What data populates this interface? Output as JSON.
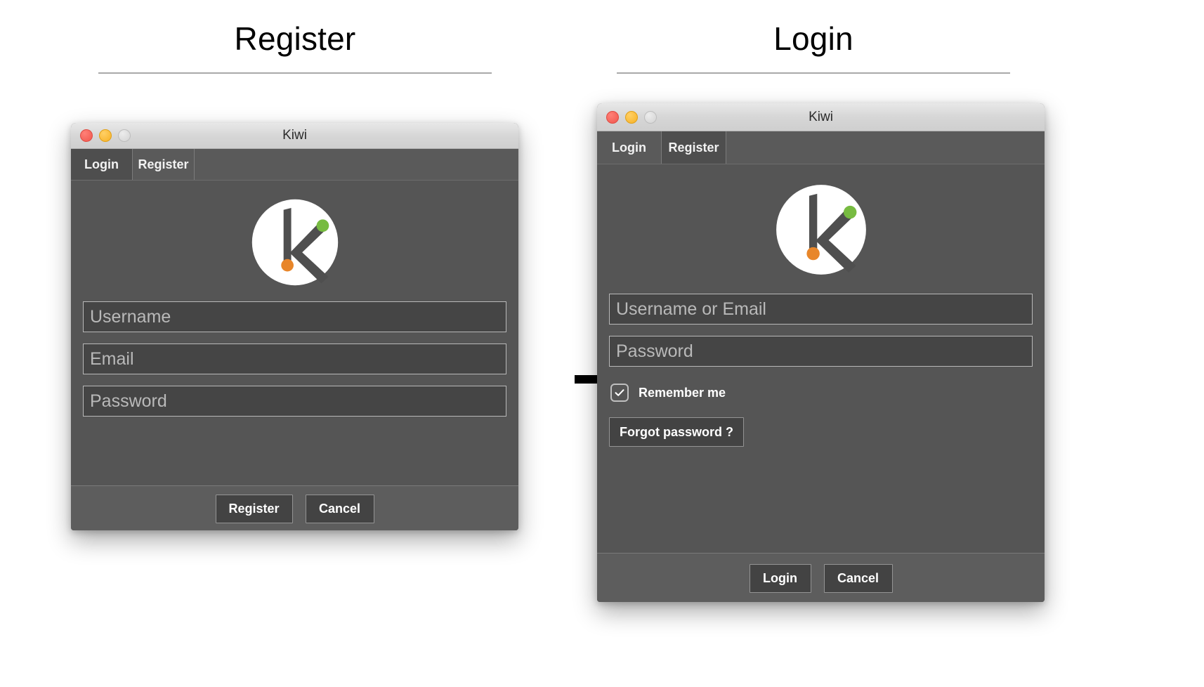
{
  "sections": [
    {
      "title": "Register"
    },
    {
      "title": "Login"
    }
  ],
  "arrow": {
    "icon": "right-arrow-icon"
  },
  "register_window": {
    "title": "Kiwi",
    "traffic_lights": {
      "close": "close-button",
      "minimize": "minimize-button",
      "zoom": "zoom-button",
      "colors": {
        "close": "#f0564d",
        "minimize": "#f7b125",
        "zoom": "#d3d3d3"
      }
    },
    "tabs": [
      {
        "label": "Login",
        "active": false
      },
      {
        "label": "Register",
        "active": true
      }
    ],
    "logo": {
      "name": "kiwi-logo",
      "circle_color": "#ffffff",
      "mark_color": "#4f4f4f",
      "dot_top_color": "#77bb41",
      "dot_bottom_color": "#e8862a"
    },
    "fields": [
      {
        "name": "username-input",
        "placeholder": "Username",
        "value": ""
      },
      {
        "name": "email-input",
        "placeholder": "Email",
        "value": ""
      },
      {
        "name": "password-input",
        "placeholder": "Password",
        "value": ""
      }
    ],
    "buttons": [
      {
        "name": "register-button",
        "label": "Register"
      },
      {
        "name": "cancel-button",
        "label": "Cancel"
      }
    ]
  },
  "login_window": {
    "title": "Kiwi",
    "traffic_lights": {
      "close": "close-button",
      "minimize": "minimize-button",
      "zoom": "zoom-button",
      "colors": {
        "close": "#f0564d",
        "minimize": "#f7b125",
        "zoom": "#d3d3d3"
      }
    },
    "tabs": [
      {
        "label": "Login",
        "active": true
      },
      {
        "label": "Register",
        "active": false
      }
    ],
    "logo": {
      "name": "kiwi-logo",
      "circle_color": "#ffffff",
      "mark_color": "#4f4f4f",
      "dot_top_color": "#77bb41",
      "dot_bottom_color": "#e8862a"
    },
    "fields": [
      {
        "name": "username-or-email-input",
        "placeholder": "Username or Email",
        "value": ""
      },
      {
        "name": "password-input",
        "placeholder": "Password",
        "value": ""
      }
    ],
    "remember_me": {
      "label": "Remember me",
      "checked": true,
      "check_glyph": "✓"
    },
    "forgot_password": {
      "label": "Forgot password ?"
    },
    "buttons": [
      {
        "name": "login-button",
        "label": "Login"
      },
      {
        "name": "cancel-button",
        "label": "Cancel"
      }
    ]
  },
  "theme": {
    "window_bg": "#555555",
    "footer_bg": "#5d5d5d",
    "field_bg": "#454545",
    "field_border": "#b9b9b9",
    "button_bg": "#434343",
    "text_muted": "#b9b9b9",
    "text_strong": "#ffffff",
    "page_bg": "#ffffff"
  }
}
